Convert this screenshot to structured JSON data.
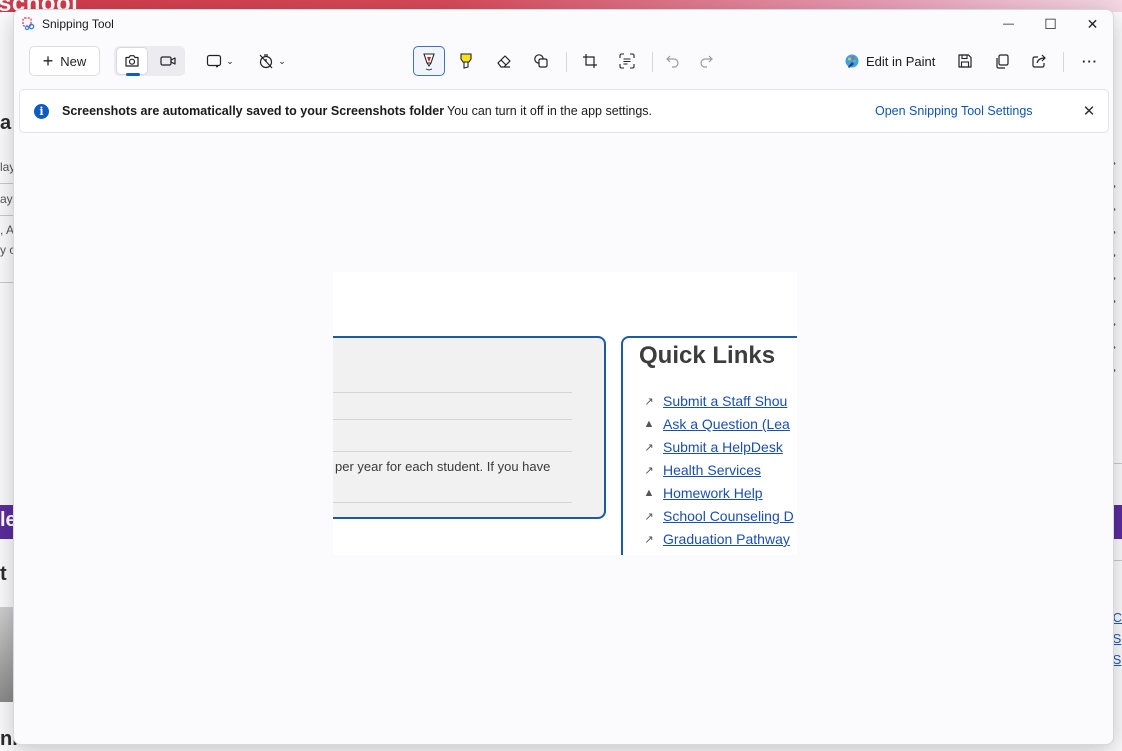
{
  "background_page": {
    "school_text": "school",
    "heading_a": "a",
    "snippets": [
      "lay",
      "ay,",
      ", A",
      "y c"
    ],
    "banner_text": "le",
    "heading_t": "t",
    "bottom_heading": "nic Courses",
    "right_links": [
      "C",
      "S",
      "S"
    ]
  },
  "window": {
    "title": "Snipping Tool",
    "controls": {
      "minimize": "—",
      "maximize": "☐",
      "close": "✕"
    }
  },
  "toolbar": {
    "new_label": "New",
    "edit_in_paint_label": "Edit in Paint",
    "more_label": "···"
  },
  "infobar": {
    "title": "Screenshots are automatically saved to your Screenshots folder",
    "message": "You can turn it off in the app settings.",
    "link": "Open Snipping Tool Settings"
  },
  "snip": {
    "card_text": "per year for each student. If you have",
    "quick_links": {
      "title": "Quick Links",
      "items": [
        {
          "label": "Submit a Staff Shou",
          "icon": "external-link"
        },
        {
          "label": "Ask a Question (Lea",
          "icon": "drive"
        },
        {
          "label": "Submit a HelpDesk",
          "icon": "external-link"
        },
        {
          "label": "Health Services",
          "icon": "external-link"
        },
        {
          "label": "Homework Help",
          "icon": "drive"
        },
        {
          "label": "School Counseling D",
          "icon": "external-link"
        },
        {
          "label": "Graduation Pathway",
          "icon": "external-link"
        }
      ]
    }
  },
  "colors": {
    "accent": "#0f5cc0",
    "snip_border": "#1b5aa6",
    "link": "#1a4fb0"
  }
}
